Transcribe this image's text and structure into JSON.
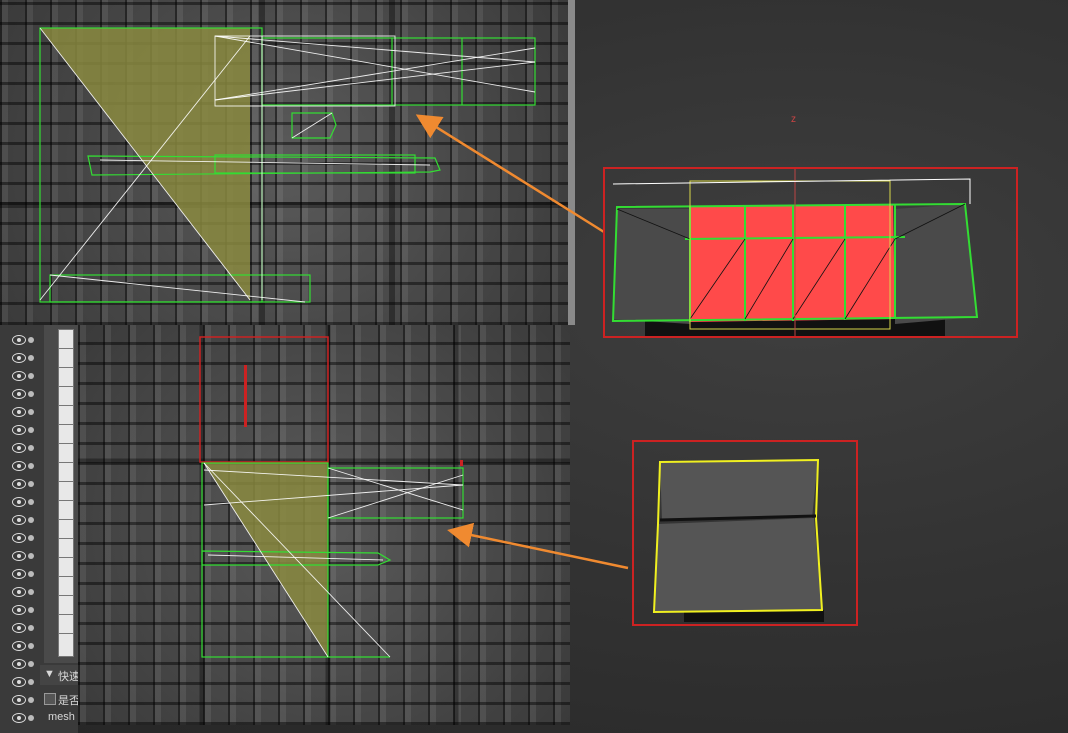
{
  "layers_panel": {
    "section_title": "快速",
    "checkbox_label": "是否",
    "layer_name": "mesh",
    "colors": {
      "panel": "#3a3a3a",
      "text": "#d8d8d8"
    }
  },
  "icons": [
    "eye-icon",
    "dot-icon",
    "triangle-expand-icon",
    "checkbox-icon"
  ],
  "colors": {
    "uv_wire": "#33dd33",
    "selection_fill": "#8a8a40",
    "red_frame": "#cc2222",
    "arrow": "#f08a30",
    "gizmo_yellow": "#f0f020",
    "selected_faces": "#ff4a4a"
  },
  "viewport": {
    "axis_label": "z"
  }
}
